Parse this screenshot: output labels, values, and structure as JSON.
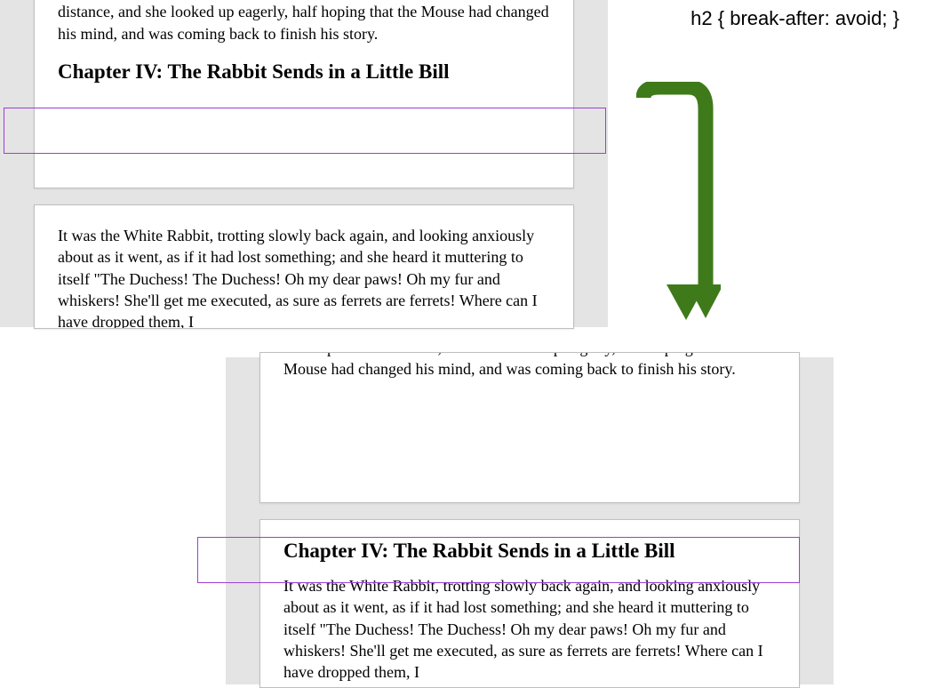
{
  "codeLabel": "h2 { break-after: avoid; }",
  "text": {
    "para_cut_top_A": "little while, however, she again heard a little pattering of footsteps in the distance, and she looked up eagerly, half hoping that the Mouse had changed his mind, and was coming back to finish his story.",
    "heading": "Chapter IV: The Rabbit Sends in a Little Bill",
    "para_rabbit": "It was the White Rabbit, trotting slowly back again, and looking anxiously about as it went, as if it had lost something; and she heard it muttering to itself \"The Duchess! The Duchess! Oh my dear paws! Oh my fur and whiskers! She'll get me executed, as sure as ferrets are ferrets! Where can I have dropped them, I",
    "para_cut_top_B": "footsteps in the distance, and she looked up eagerly, half hoping that the Mouse had changed his mind, and was coming back to finish his story."
  }
}
